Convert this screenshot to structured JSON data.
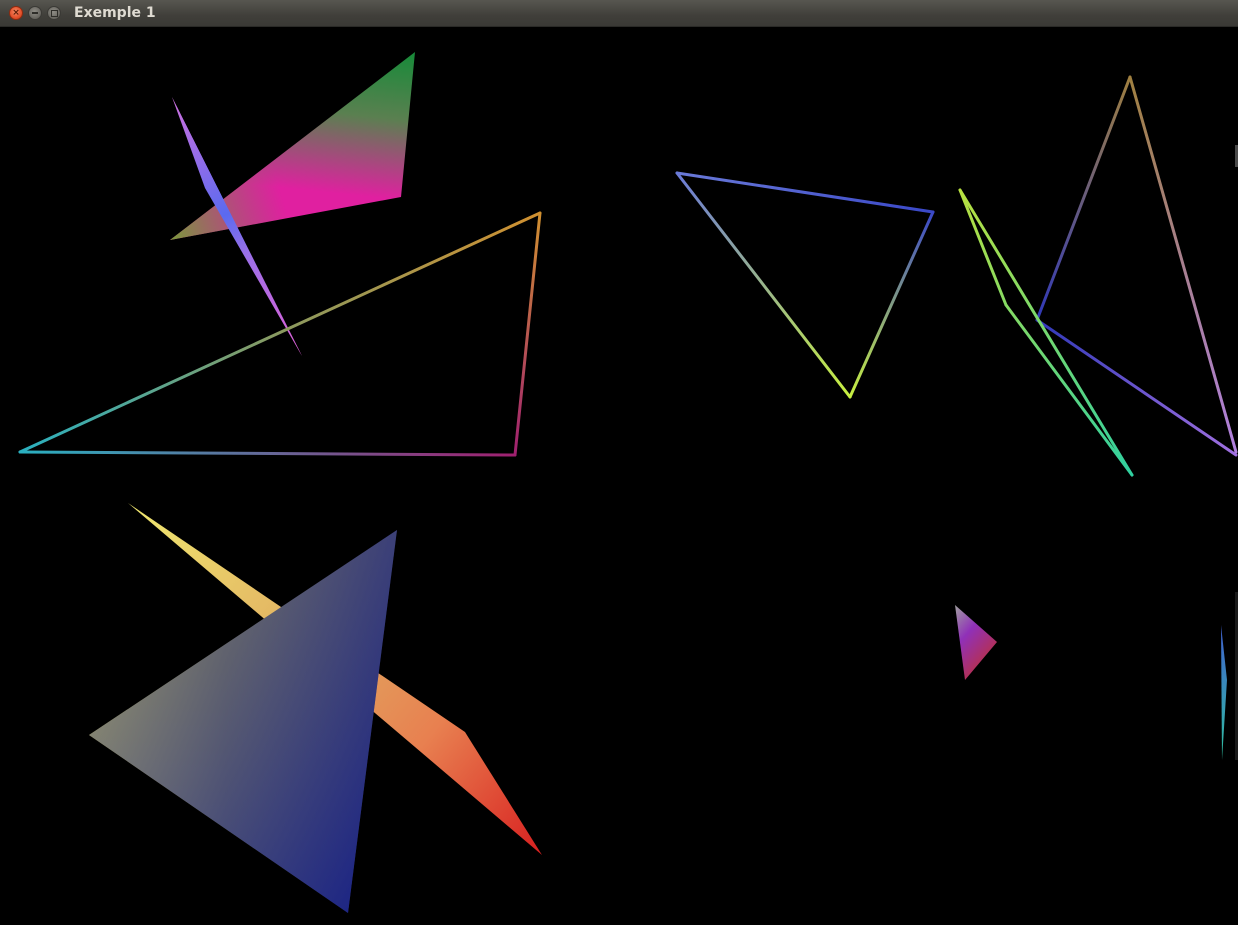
{
  "window": {
    "title": "Exemple 1",
    "close_icon": "close-icon",
    "minimize_icon": "minimize-icon",
    "maximize_icon": "maximize-icon"
  },
  "canvas": {
    "background": "#000000"
  }
}
